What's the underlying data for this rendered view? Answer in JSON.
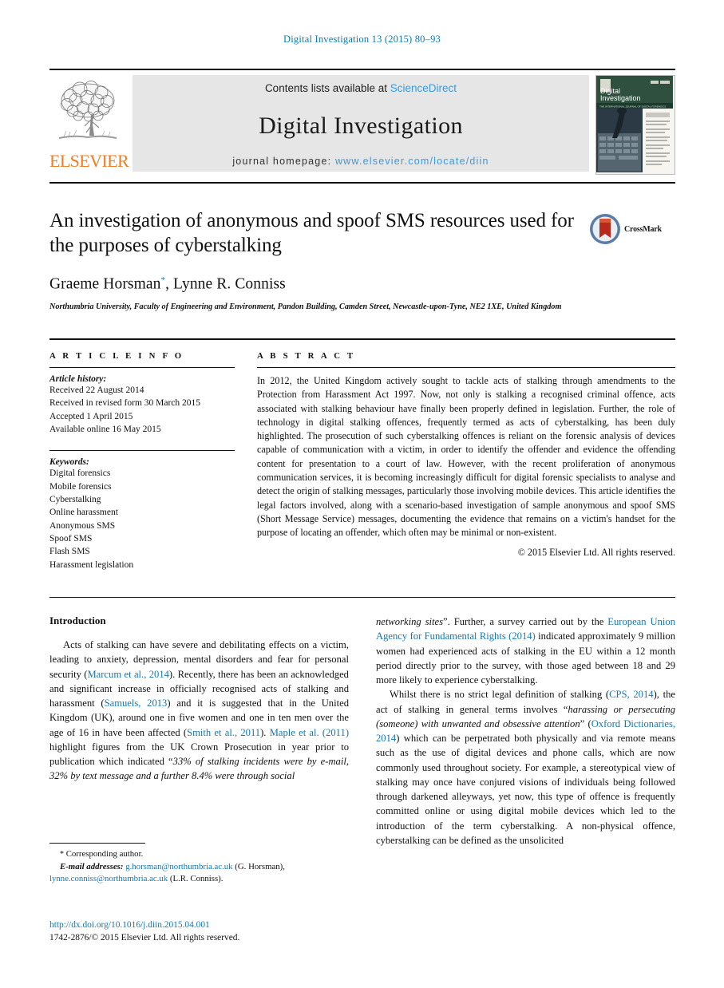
{
  "running_head": "Digital Investigation 13 (2015) 80–93",
  "masthead": {
    "publisher_name": "ELSEVIER",
    "contents_prefix": "Contents lists available at ",
    "contents_link": "ScienceDirect",
    "journal_name": "Digital Investigation",
    "homepage_prefix": "journal homepage: ",
    "homepage_url": "www.elsevier.com/locate/diin",
    "cover_title_line1": "Digital",
    "cover_title_line2": "Investigation",
    "cover_subtitle": "THE INTERNATIONAL JOURNAL OF DIGITAL FORENSICS & INCIDENT RESPONSE"
  },
  "article": {
    "title": "An investigation of anonymous and spoof SMS resources used for the purposes of cyberstalking",
    "crossmark_label": "CrossMark",
    "authors": "Graeme Horsman",
    "author_marker": "*",
    "authors_rest": ", Lynne R. Conniss",
    "affiliation": "Northumbria University, Faculty of Engineering and Environment, Pandon Building, Camden Street, Newcastle-upon-Tyne, NE2 1XE, United Kingdom"
  },
  "article_info": {
    "heading": "A R T I C L E   I N F O",
    "history_label": "Article history:",
    "history": [
      "Received 22 August 2014",
      "Received in revised form 30 March 2015",
      "Accepted 1 April 2015",
      "Available online 16 May 2015"
    ],
    "keywords_label": "Keywords:",
    "keywords": [
      "Digital forensics",
      "Mobile forensics",
      "Cyberstalking",
      "Online harassment",
      "Anonymous SMS",
      "Spoof SMS",
      "Flash SMS",
      "Harassment legislation"
    ]
  },
  "abstract": {
    "heading": "A B S T R A C T",
    "body": "In 2012, the United Kingdom actively sought to tackle acts of stalking through amendments to the Protection from Harassment Act 1997. Now, not only is stalking a recognised criminal offence, acts associated with stalking behaviour have finally been properly defined in legislation. Further, the role of technology in digital stalking offences, frequently termed as acts of cyberstalking, has been duly highlighted. The prosecution of such cyberstalking offences is reliant on the forensic analysis of devices capable of communication with a victim, in order to identify the offender and evidence the offending content for presentation to a court of law. However, with the recent proliferation of anonymous communication services, it is becoming increasingly difficult for digital forensic specialists to analyse and detect the origin of stalking messages, particularly those involving mobile devices. This article identifies the legal factors involved, along with a scenario-based investigation of sample anonymous and spoof SMS (Short Message Service) messages, documenting the evidence that remains on a victim's handset for the purpose of locating an offender, which often may be minimal or non-existent.",
    "copyright": "© 2015 Elsevier Ltd. All rights reserved."
  },
  "body": {
    "section_title": "Introduction",
    "left_column": {
      "paragraph_1_parts": [
        {
          "t": "Acts of stalking can have severe and debilitating effects on a victim, leading to anxiety, depression, mental disorders and fear for personal security (",
          "s": "plain"
        },
        {
          "t": "Marcum et al., 2014",
          "s": "link"
        },
        {
          "t": "). Recently, there has been an acknowledged and significant increase in officially recognised acts of stalking and harassment (",
          "s": "plain"
        },
        {
          "t": "Samuels, 2013",
          "s": "link"
        },
        {
          "t": ") and it is suggested that in the United Kingdom (UK), around one in five women and one in ten men over the age of 16 in have been affected (",
          "s": "plain"
        },
        {
          "t": "Smith et al., 2011",
          "s": "link"
        },
        {
          "t": "). ",
          "s": "plain"
        },
        {
          "t": "Maple et al. (2011)",
          "s": "link"
        },
        {
          "t": " highlight figures from the UK Crown Prosecution in year prior to publication which indicated “",
          "s": "plain"
        },
        {
          "t": "33% of stalking incidents were by e-mail, 32% by text message and a further 8.4% were through social",
          "s": "italic"
        }
      ]
    },
    "right_column": {
      "paragraph_1_parts": [
        {
          "t": "networking sites",
          "s": "italic"
        },
        {
          "t": "”. Further, a survey carried out by the ",
          "s": "plain"
        },
        {
          "t": "European Union Agency for Fundamental Rights (2014)",
          "s": "link"
        },
        {
          "t": " indicated approximately 9 million women had experienced acts of stalking in the EU within a 12 month period directly prior to the survey, with those aged between 18 and 29 more likely to experience cyberstalking.",
          "s": "plain"
        }
      ],
      "paragraph_2_parts": [
        {
          "t": "Whilst there is no strict legal definition of stalking (",
          "s": "plain"
        },
        {
          "t": "CPS, 2014",
          "s": "link"
        },
        {
          "t": "), the act of stalking in general terms involves “",
          "s": "plain"
        },
        {
          "t": "harassing or persecuting (someone) with unwanted and obsessive attention",
          "s": "italic"
        },
        {
          "t": "” (",
          "s": "plain"
        },
        {
          "t": "Oxford Dictionaries, 2014",
          "s": "link"
        },
        {
          "t": ") which can be perpetrated both physically and via remote means such as the use of digital devices and phone calls, which are now commonly used throughout society. For example, a stereotypical view of stalking may once have conjured visions of individuals being followed through darkened alleyways, yet now, this type of offence is frequently committed online or using digital mobile devices which led to the introduction of the term cyberstalking. A non-physical offence, cyberstalking can be defined as the unsolicited",
          "s": "plain"
        }
      ]
    }
  },
  "footnote": {
    "corresponding_marker": "*",
    "corresponding_text": "Corresponding author.",
    "email_label": "E-mail addresses:",
    "email_1": "g.horsman@northumbria.ac.uk",
    "email_1_owner": "(G. Horsman),",
    "email_2": "lynne.conniss@northumbria.ac.uk",
    "email_2_owner": "(L.R. Conniss)."
  },
  "publication": {
    "doi": "http://dx.doi.org/10.1016/j.diin.2015.04.001",
    "issn_line": "1742-2876/© 2015 Elsevier Ltd. All rights reserved."
  },
  "colors": {
    "link_blue": "#1577ad",
    "sciencedirect_blue": "#3a9bd9",
    "elsevier_orange": "#ef7d22",
    "band_gray": "#e6e6e6"
  }
}
